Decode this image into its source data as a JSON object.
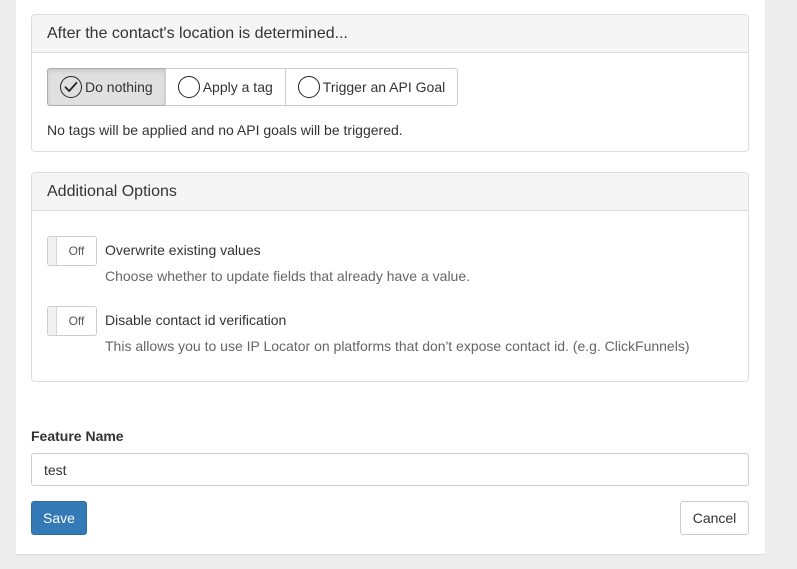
{
  "location_panel": {
    "title": "After the contact's location is determined...",
    "options": [
      {
        "label": "Do nothing",
        "icon": "radio-checked-icon",
        "selected": true
      },
      {
        "label": "Apply a tag",
        "icon": "radio-empty-icon",
        "selected": false
      },
      {
        "label": "Trigger an API Goal",
        "icon": "radio-empty-icon",
        "selected": false
      }
    ],
    "help_text": "No tags will be applied and no API goals will be triggered."
  },
  "additional_options": {
    "title": "Additional Options",
    "items": [
      {
        "toggle_state": "Off",
        "title": "Overwrite existing values",
        "description": "Choose whether to update fields that already have a value."
      },
      {
        "toggle_state": "Off",
        "title": "Disable contact id verification",
        "description": "This allows you to use IP Locator on platforms that don't expose contact id. (e.g. ClickFunnels)"
      }
    ]
  },
  "feature_name": {
    "label": "Feature Name",
    "value": "test"
  },
  "actions": {
    "save_label": "Save",
    "cancel_label": "Cancel"
  },
  "colors": {
    "primary": "#337ab7",
    "active_option_bg": "#e0e0e0",
    "panel_header_bg": "#f5f5f5",
    "page_bg": "#ededed"
  }
}
